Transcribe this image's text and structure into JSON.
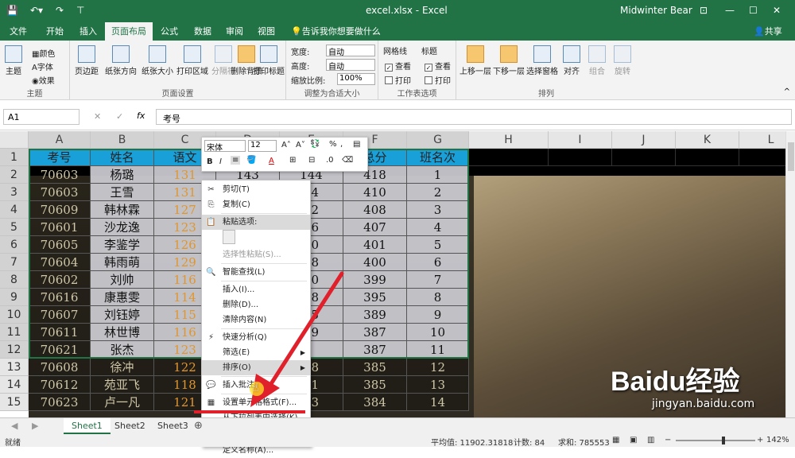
{
  "titlebar": {
    "filename": "excel.xlsx",
    "app": "Excel",
    "user": "Midwinter Bear"
  },
  "tabs": [
    {
      "label": "文件"
    },
    {
      "label": "开始"
    },
    {
      "label": "插入"
    },
    {
      "label": "页面布局"
    },
    {
      "label": "公式"
    },
    {
      "label": "数据"
    },
    {
      "label": "审阅"
    },
    {
      "label": "视图"
    }
  ],
  "tell_me": "告诉我你想要做什么",
  "share": "共享",
  "ribbon": {
    "theme": {
      "main": "主题",
      "colors": "颜色",
      "fonts": "字体",
      "effects": "效果",
      "group": "主题"
    },
    "page_setup": {
      "margins": "页边距",
      "orientation": "纸张方向",
      "size": "纸张大小",
      "print_area": "打印区域",
      "breaks": "分隔符",
      "background": "删除背景",
      "print_titles": "打印标题",
      "group": "页面设置"
    },
    "scale": {
      "width_label": "宽度:",
      "width_val": "自动",
      "height_label": "高度:",
      "height_val": "自动",
      "scale_label": "缩放比例:",
      "scale_val": "100%",
      "group": "调整为合适大小"
    },
    "sheet_opts": {
      "gridlines": "网格线",
      "headings": "标题",
      "view": "查看",
      "print": "打印",
      "group": "工作表选项"
    },
    "arrange": {
      "forward": "上移一层",
      "backward": "下移一层",
      "pane": "选择窗格",
      "align": "对齐",
      "group_btn": "组合",
      "rotate": "旋转",
      "group": "排列"
    }
  },
  "formula_bar": {
    "name_box": "A1",
    "fx": "fx",
    "content": "考号"
  },
  "columns": [
    "A",
    "B",
    "C",
    "D",
    "E",
    "F",
    "G",
    "H",
    "I",
    "J",
    "K",
    "L"
  ],
  "rows": [
    "1",
    "2",
    "3",
    "4",
    "5",
    "6",
    "7",
    "8",
    "9",
    "10",
    "11",
    "12",
    "13",
    "14",
    "15"
  ],
  "header_row": [
    "考号",
    "姓名",
    "语文",
    "",
    "",
    "总分",
    "班名次"
  ],
  "data_rows": [
    [
      "70603",
      "杨璐",
      "131",
      "143",
      "144",
      "418",
      "1"
    ],
    [
      "70603",
      "王雪",
      "131",
      "",
      "44",
      "410",
      "2"
    ],
    [
      "70609",
      "韩林霖",
      "127",
      "",
      "42",
      "408",
      "3"
    ],
    [
      "70601",
      "沙龙逸",
      "123",
      "",
      "36",
      "407",
      "4"
    ],
    [
      "70605",
      "李鉴学",
      "126",
      "",
      "40",
      "401",
      "5"
    ],
    [
      "70604",
      "韩雨萌",
      "129",
      "",
      "38",
      "400",
      "6"
    ],
    [
      "70602",
      "刘帅",
      "116",
      "",
      "40",
      "399",
      "7"
    ],
    [
      "70616",
      "康惠雯",
      "114",
      "",
      "38",
      "395",
      "8"
    ],
    [
      "70607",
      "刘钰婷",
      "115",
      "",
      "35",
      "389",
      "9"
    ],
    [
      "70611",
      "林世博",
      "116",
      "",
      "29",
      "387",
      "10"
    ],
    [
      "70621",
      "张杰",
      "123",
      "",
      "",
      "387",
      "11"
    ],
    [
      "70608",
      "徐冲",
      "122",
      "",
      "18",
      "385",
      "12"
    ],
    [
      "70612",
      "苑亚飞",
      "118",
      "",
      "31",
      "385",
      "13"
    ],
    [
      "70623",
      "卢一凡",
      "121",
      "",
      "33",
      "384",
      "14"
    ]
  ],
  "mini_toolbar": {
    "font": "宋体",
    "size": "12"
  },
  "context_menu": [
    {
      "label": "剪切(T)",
      "icon": "scissors-icon"
    },
    {
      "label": "复制(C)",
      "icon": "copy-icon"
    },
    {
      "label": "粘贴选项:",
      "icon": "paste-icon"
    },
    {
      "label": "选择性粘贴(S)...",
      "icon": ""
    },
    {
      "label": "智能查找(L)",
      "icon": "search-icon"
    },
    {
      "label": "插入(I)...",
      "icon": ""
    },
    {
      "label": "删除(D)...",
      "icon": ""
    },
    {
      "label": "清除内容(N)",
      "icon": ""
    },
    {
      "label": "快速分析(Q)",
      "icon": "quick-analysis-icon"
    },
    {
      "label": "筛选(E)",
      "icon": ""
    },
    {
      "label": "排序(O)",
      "icon": ""
    },
    {
      "label": "插入批注(M)",
      "icon": "comment-icon"
    },
    {
      "label": "设置单元格格式(F)...",
      "icon": "format-cells-icon"
    },
    {
      "label": "从下拉列表中选择(K)...",
      "icon": ""
    },
    {
      "label": "显示拼音字段(S)",
      "icon": "phonetic-icon"
    },
    {
      "label": "定义名称(A)...",
      "icon": ""
    }
  ],
  "sheets": [
    "Sheet1",
    "Sheet2",
    "Sheet3"
  ],
  "status": {
    "ready": "就绪",
    "average": "平均值: 11902.31818",
    "count": "计数: 84",
    "sum": "求和: 785553",
    "zoom": "142%"
  },
  "watermark": {
    "brand": "Baidu经验",
    "url": "jingyan.baidu.com"
  },
  "colors": {
    "excel_green": "#217346",
    "header_fill": "#1aa0d8",
    "annotation_red": "#e0202a"
  }
}
